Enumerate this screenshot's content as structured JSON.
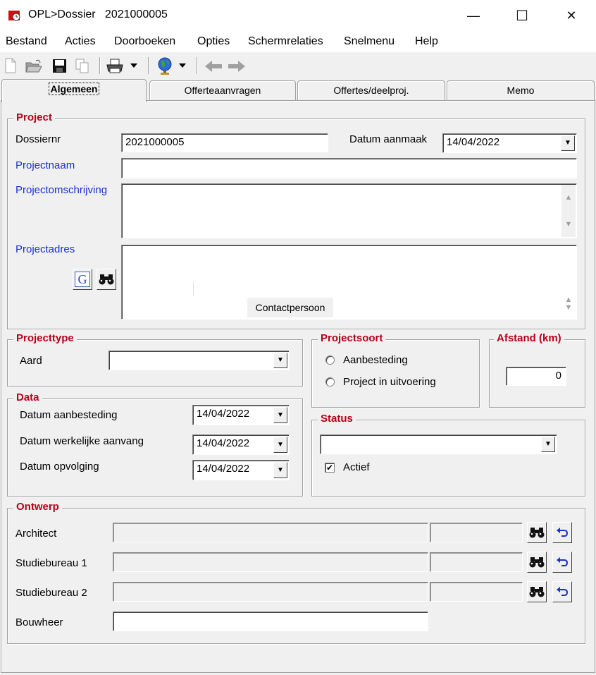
{
  "window": {
    "title": "OPL>Dossier   2021000005",
    "minimize_glyph": "—",
    "maximize_glyph": "☐",
    "close_glyph": "✕"
  },
  "menu": [
    "Bestand",
    "Acties",
    "Doorboeken",
    "Opties",
    "Schermrelaties",
    "Snelmenu",
    "Help"
  ],
  "toolbar": {
    "icons": [
      "new-icon",
      "open-icon",
      "save-icon",
      "copy-icon",
      "print-icon",
      "globe-icon",
      "back-arrow-icon",
      "forward-arrow-icon"
    ]
  },
  "tabs": [
    "Algemeen",
    "Offerteaanvragen",
    "Offertes/deelproj.",
    "Memo"
  ],
  "project": {
    "title": "Project",
    "dossiernr_label": "Dossiernr",
    "dossiernr_value": "2021000005",
    "datum_aanmaak_label": "Datum aanmaak",
    "datum_aanmaak_value": "14/04/2022",
    "projectnaam_label": "Projectnaam",
    "projectnaam_value": "",
    "projectomschrijving_label": "Projectomschrijving",
    "projectomschrijving_value": "",
    "projectadres_label": "Projectadres",
    "contactpersoon_label": "Contactpersoon"
  },
  "projecttype": {
    "title": "Projecttype",
    "aard_label": "Aard",
    "aard_value": ""
  },
  "projectsoort": {
    "title": "Projectsoort",
    "options": [
      "Aanbesteding",
      "Project in uitvoering"
    ]
  },
  "afstand": {
    "title": "Afstand (km)",
    "value": "0"
  },
  "data_group": {
    "title": "Data",
    "rows": [
      {
        "label": "Datum aanbesteding",
        "value": "14/04/2022"
      },
      {
        "label": "Datum werkelijke aanvang",
        "value": "14/04/2022"
      },
      {
        "label": "Datum opvolging",
        "value": "14/04/2022"
      }
    ]
  },
  "status": {
    "title": "Status",
    "value": "",
    "actief_label": "Actief",
    "actief_checked": true
  },
  "ontwerp": {
    "title": "Ontwerp",
    "rows": [
      {
        "label": "Architect"
      },
      {
        "label": "Studiebureau 1"
      },
      {
        "label": "Studiebureau 2"
      }
    ],
    "bouwheer_label": "Bouwheer",
    "bouwheer_value": ""
  },
  "colors": {
    "group_title": "#b8001a",
    "link_label": "#1a2fd1",
    "background": "#f0f0f0"
  }
}
